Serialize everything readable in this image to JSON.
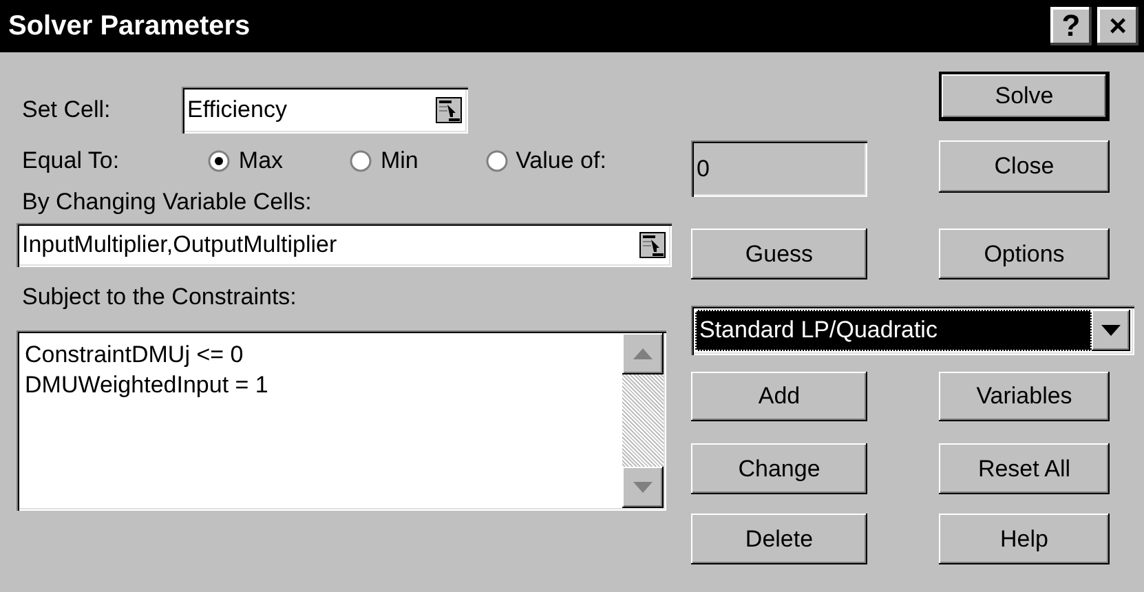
{
  "window": {
    "title": "Solver Parameters",
    "help_button": "?",
    "close_button": "×"
  },
  "set_cell": {
    "label": "Set Cell:",
    "value": "Efficiency"
  },
  "equal_to": {
    "label": "Equal To:",
    "options": [
      {
        "label": "Max",
        "selected": true
      },
      {
        "label": "Min",
        "selected": false
      },
      {
        "label": "Value of:",
        "selected": false
      }
    ]
  },
  "value_of": {
    "value": "0",
    "disabled": true
  },
  "by_changing": {
    "label": "By Changing Variable Cells:",
    "value": "InputMultiplier,OutputMultiplier"
  },
  "constraints": {
    "label": "Subject to the Constraints:",
    "items": [
      "ConstraintDMUj <= 0",
      "DMUWeightedInput = 1"
    ]
  },
  "solving_method": {
    "value": "Standard LP/Quadratic"
  },
  "buttons": [
    {
      "label": "Solve",
      "default": true
    },
    {
      "label": "Close",
      "default": false
    },
    {
      "label": "Guess",
      "default": false
    },
    {
      "label": "Options",
      "default": false
    },
    {
      "label": "Add",
      "default": false
    },
    {
      "label": "Variables",
      "default": false
    },
    {
      "label": "Change",
      "default": false
    },
    {
      "label": "Reset All",
      "default": false
    },
    {
      "label": "Delete",
      "default": false
    },
    {
      "label": "Help",
      "default": false
    }
  ]
}
